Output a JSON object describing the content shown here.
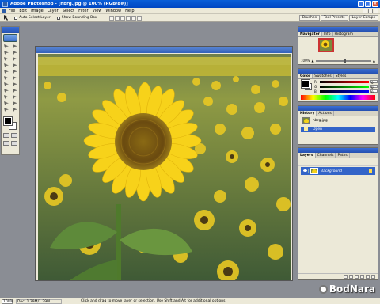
{
  "window": {
    "title": "Adobe Photoshop - [hbrg.jpg @ 100% (RGB/8#)]",
    "controls": [
      "_",
      "□",
      "×"
    ]
  },
  "menu": {
    "items": [
      "File",
      "Edit",
      "Image",
      "Layer",
      "Select",
      "Filter",
      "View",
      "Window",
      "Help"
    ]
  },
  "options": {
    "auto_select": "Auto Select Layer",
    "bounding_box": "Show Bounding Box"
  },
  "palette_well": {
    "tabs": [
      "Brushes",
      "Tool Presets",
      "Layer Comps"
    ]
  },
  "navigator": {
    "tabs": [
      "Navigator",
      "Info",
      "Histogram"
    ],
    "zoom": "100%"
  },
  "color": {
    "tabs": [
      "Color",
      "Swatches",
      "Styles"
    ],
    "channels": [
      {
        "label": "R",
        "value": "0"
      },
      {
        "label": "G",
        "value": "0"
      },
      {
        "label": "B",
        "value": "0"
      }
    ]
  },
  "history": {
    "tabs": [
      "History",
      "Actions"
    ],
    "snapshot": "hbrg.jpg",
    "state": "Open"
  },
  "layers": {
    "tabs": [
      "Layers",
      "Channels",
      "Paths"
    ],
    "layer_name": "Background"
  },
  "status": {
    "zoom": "100%",
    "doc_size": "Doc: 1.29M/1.29M",
    "hint": "Click and drag to move layer or selection.  Use Shift and Alt for additional options."
  },
  "watermark": {
    "text": "BodNara"
  }
}
